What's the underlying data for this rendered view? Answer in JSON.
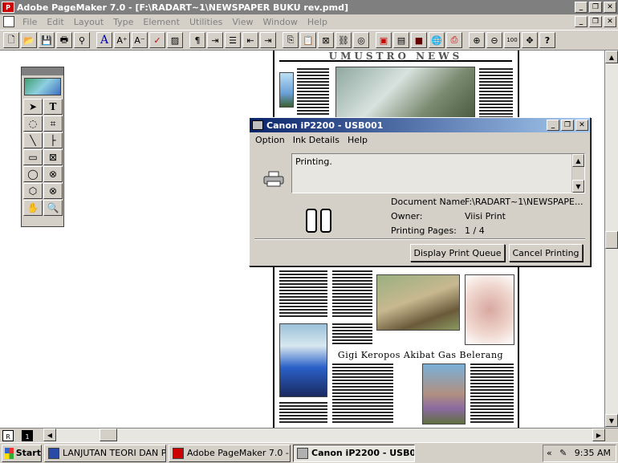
{
  "app": {
    "title": "Adobe PageMaker 7.0 - [F:\\RADART~1\\NEWSPAPER BUKU rev.pmd]",
    "menus": [
      "File",
      "Edit",
      "Layout",
      "Type",
      "Element",
      "Utilities",
      "View",
      "Window",
      "Help"
    ]
  },
  "newspaper": {
    "masthead": "UMUSTRO NEWS",
    "headline": "Gigi Keropos Akibat Gas Belerang"
  },
  "dialog": {
    "title": "Canon iP2200 - USB001",
    "menus": [
      "Option",
      "Ink Details",
      "Help"
    ],
    "status": "Printing.",
    "labels": {
      "doc_name": "Document Name:",
      "owner": "Owner:",
      "pages": "Printing Pages:"
    },
    "values": {
      "doc_name": "F:\\RADART~1\\NEWSPAPE...",
      "owner": "Viisi Print",
      "pages": "1 / 4"
    },
    "buttons": {
      "queue": "Display Print Queue",
      "cancel": "Cancel Printing"
    }
  },
  "pages": {
    "master": "R",
    "current": "1"
  },
  "taskbar": {
    "start": "Start",
    "tasks": [
      "LANJUTAN TEORI DAN P...",
      "Adobe PageMaker 7.0 - [...",
      "Canon iP2200 - USB001"
    ],
    "tray_arrows": "«",
    "time": "9:35 AM"
  },
  "icons": {
    "minimize": "_",
    "restore": "❐",
    "close": "✕"
  }
}
